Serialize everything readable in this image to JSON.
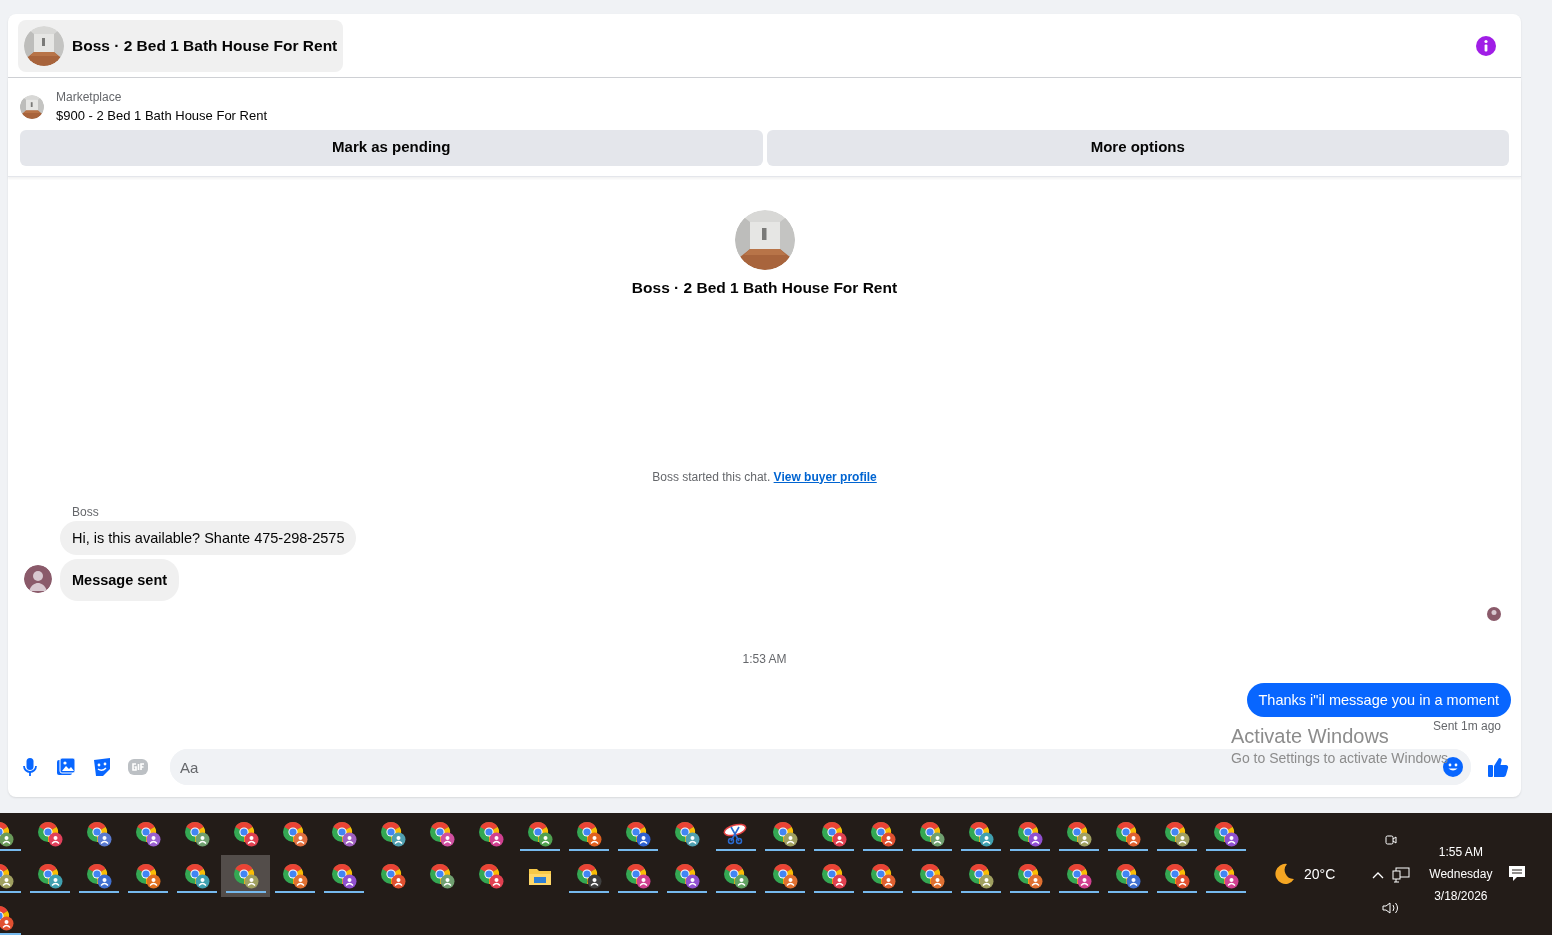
{
  "conversation": {
    "title": "Boss · 2 Bed 1 Bath House For Rent"
  },
  "listing": {
    "source": "Marketplace",
    "summary": "$900 - 2 Bed 1 Bath House For Rent"
  },
  "actions": [
    "Mark as pending",
    "More options"
  ],
  "intro": {
    "title": "Boss · 2 Bed 1 Bath House For Rent",
    "notice": "Boss started this chat.",
    "link": "View buyer profile"
  },
  "incoming": {
    "sender": "Boss",
    "bubbles": [
      {
        "text": "Hi, is this available? Shante 475-298-2575",
        "emphasis": false
      },
      {
        "text": "Message sent",
        "emphasis": true
      }
    ]
  },
  "timestamp": "1:53 AM",
  "outgoing": {
    "text": "Thanks i\"il message you in a moment",
    "status": "Sent 1m ago"
  },
  "composer": {
    "placeholder": "Aa"
  },
  "os_watermark": {
    "title": "Activate Windows",
    "subtitle": "Go to Settings to activate Windows"
  },
  "taskbar": {
    "rows": [
      [
        {
          "kind": "browser",
          "color": "#6a9a5a",
          "running": true,
          "selected": false
        },
        {
          "kind": "browser",
          "color": "#e0405a",
          "running": false,
          "selected": false
        },
        {
          "kind": "browser",
          "color": "#5a7ad0",
          "running": false,
          "selected": false
        },
        {
          "kind": "browser",
          "color": "#9a60d0",
          "running": false,
          "selected": false
        },
        {
          "kind": "browser",
          "color": "#70a070",
          "running": false,
          "selected": false
        },
        {
          "kind": "browser",
          "color": "#e04050",
          "running": false,
          "selected": false
        },
        {
          "kind": "browser",
          "color": "#e07040",
          "running": false,
          "selected": false
        },
        {
          "kind": "browser",
          "color": "#a060c0",
          "running": false,
          "selected": false
        },
        {
          "kind": "browser",
          "color": "#50a0b0",
          "running": false,
          "selected": false
        },
        {
          "kind": "browser",
          "color": "#d050a0",
          "running": false,
          "selected": false
        },
        {
          "kind": "browser",
          "color": "#d04090",
          "running": false,
          "selected": false
        },
        {
          "kind": "browser",
          "color": "#50a050",
          "running": true,
          "selected": false
        },
        {
          "kind": "browser",
          "color": "#e06020",
          "running": true,
          "selected": false
        },
        {
          "kind": "browser",
          "color": "#3060d0",
          "running": true,
          "selected": false
        },
        {
          "kind": "browser",
          "color": "#50a0b0",
          "running": false,
          "selected": false
        },
        {
          "kind": "snip",
          "running": true,
          "selected": false
        },
        {
          "kind": "browser",
          "color": "#a0a060",
          "running": true,
          "selected": false
        },
        {
          "kind": "browser",
          "color": "#e04050",
          "running": true,
          "selected": false
        },
        {
          "kind": "browser",
          "color": "#e05030",
          "running": true,
          "selected": false
        },
        {
          "kind": "browser",
          "color": "#70a070",
          "running": true,
          "selected": false
        },
        {
          "kind": "browser",
          "color": "#40a0b0",
          "running": true,
          "selected": false
        },
        {
          "kind": "browser",
          "color": "#9050d0",
          "running": true,
          "selected": false
        },
        {
          "kind": "browser",
          "color": "#a0a060",
          "running": true,
          "selected": false
        },
        {
          "kind": "browser",
          "color": "#e06030",
          "running": true,
          "selected": false
        },
        {
          "kind": "browser",
          "color": "#a0a060",
          "running": true,
          "selected": false
        },
        {
          "kind": "browser",
          "color": "#9050d0",
          "running": true,
          "selected": false
        }
      ],
      [
        {
          "kind": "browser",
          "color": "#a0a060",
          "running": true,
          "selected": false
        },
        {
          "kind": "browser",
          "color": "#40a0b0",
          "running": true,
          "selected": false
        },
        {
          "kind": "browser",
          "color": "#4070d0",
          "running": true,
          "selected": false
        },
        {
          "kind": "browser",
          "color": "#e07020",
          "running": true,
          "selected": false
        },
        {
          "kind": "browser",
          "color": "#40a0b0",
          "running": true,
          "selected": false
        },
        {
          "kind": "browser",
          "color": "#a0a060",
          "running": true,
          "selected": true
        },
        {
          "kind": "browser",
          "color": "#e07030",
          "running": true,
          "selected": false
        },
        {
          "kind": "browser",
          "color": "#9050d0",
          "running": true,
          "selected": false
        },
        {
          "kind": "browser",
          "color": "#e05030",
          "running": false,
          "selected": false
        },
        {
          "kind": "browser",
          "color": "#70a070",
          "running": false,
          "selected": false
        },
        {
          "kind": "browser",
          "color": "#e04050",
          "running": false,
          "selected": false
        },
        {
          "kind": "folder",
          "running": false,
          "selected": false
        },
        {
          "kind": "browser",
          "color": "#404040",
          "running": true,
          "selected": false
        },
        {
          "kind": "browser",
          "color": "#d04090",
          "running": true,
          "selected": false
        },
        {
          "kind": "browser",
          "color": "#9050d0",
          "running": true,
          "selected": false
        },
        {
          "kind": "browser",
          "color": "#60a060",
          "running": true,
          "selected": false
        },
        {
          "kind": "browser",
          "color": "#e07030",
          "running": true,
          "selected": false
        },
        {
          "kind": "browser",
          "color": "#e04050",
          "running": true,
          "selected": false
        },
        {
          "kind": "browser",
          "color": "#e06030",
          "running": true,
          "selected": false
        },
        {
          "kind": "browser",
          "color": "#e07031",
          "running": true,
          "selected": false
        },
        {
          "kind": "browser",
          "color": "#a0a060",
          "running": true,
          "selected": false
        },
        {
          "kind": "browser",
          "color": "#e07030",
          "running": true,
          "selected": false
        },
        {
          "kind": "browser",
          "color": "#d04090",
          "running": true,
          "selected": false
        },
        {
          "kind": "browser",
          "color": "#4070d0",
          "running": true,
          "selected": false
        },
        {
          "kind": "browser",
          "color": "#e05030",
          "running": true,
          "selected": false
        },
        {
          "kind": "browser",
          "color": "#d04090",
          "running": true,
          "selected": false
        }
      ],
      [
        {
          "kind": "browser",
          "color": "#e05030",
          "running": true,
          "selected": false
        }
      ]
    ],
    "weather": {
      "temperature": "20°C"
    },
    "clock": {
      "time": "1:55 AM",
      "day": "Wednesday",
      "date": "3/18/2026"
    }
  }
}
